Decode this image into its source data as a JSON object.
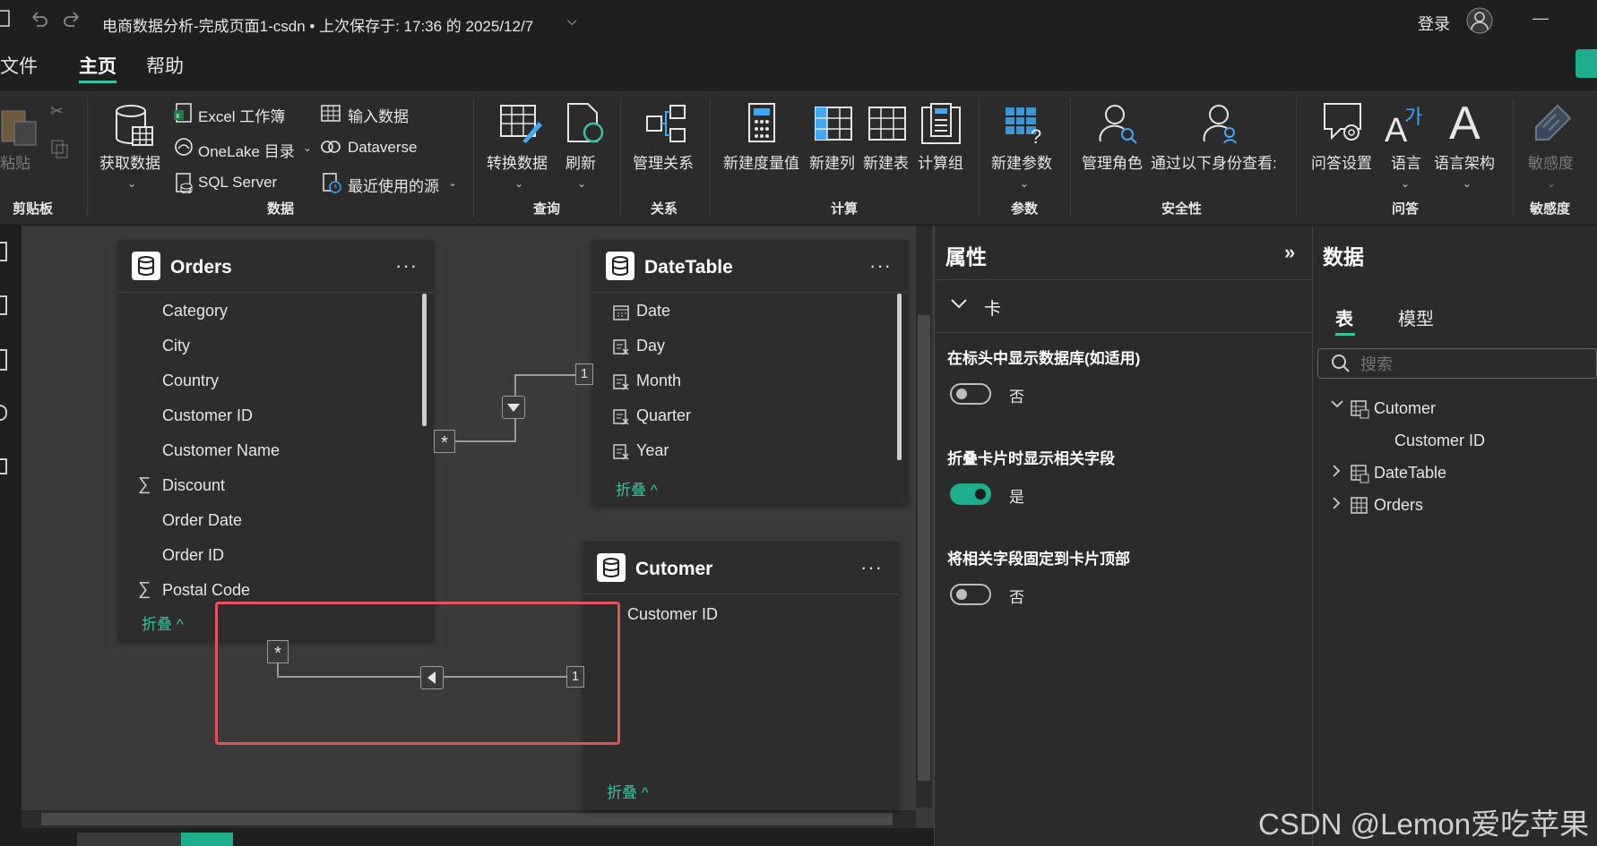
{
  "titlebar": {
    "title": "电商数据分析-完成页面1-csdn • 上次保存于: 17:36 的 2025/12/7",
    "login": "登录",
    "minimize": "—"
  },
  "menu": {
    "items": [
      "文件",
      "主页",
      "帮助"
    ],
    "active": "主页"
  },
  "ribbon": {
    "clipboard": {
      "paste": "粘贴",
      "group": "剪贴板"
    },
    "data": {
      "get_data": "获取数据",
      "excel": "Excel 工作簿",
      "onelake": "OneLake 目录",
      "sql": "SQL Server",
      "enter_data": "输入数据",
      "dataverse": "Dataverse",
      "recent": "最近使用的源",
      "group": "数据"
    },
    "query": {
      "transform": "转换数据",
      "refresh": "刷新",
      "group": "查询"
    },
    "relationships": {
      "manage": "管理关系",
      "group": "关系"
    },
    "calc": {
      "new_measure": "新建度量值",
      "new_column": "新建列",
      "new_table": "新建表",
      "calc_group": "计算组",
      "group": "计算"
    },
    "params": {
      "new_param": "新建参数",
      "group": "参数"
    },
    "security": {
      "manage_roles": "管理角色",
      "view_as": "通过以下身份查看:",
      "group": "安全性"
    },
    "qa": {
      "qa_settings": "问答设置",
      "language": "语言",
      "linguistic": "语言架构",
      "group": "问答"
    },
    "sensitivity": {
      "label": "敏感度",
      "group": "敏感度"
    }
  },
  "cards": {
    "orders": {
      "title": "Orders",
      "fields": [
        "Category",
        "City",
        "Country",
        "Customer ID",
        "Customer Name",
        "Discount",
        "Order Date",
        "Order ID",
        "Postal Code"
      ],
      "collapse": "折叠 ^"
    },
    "datetable": {
      "title": "DateTable",
      "fields": [
        "Date",
        "Day",
        "Month",
        "Quarter",
        "Year"
      ],
      "collapse": "折叠 ^"
    },
    "cutomer": {
      "title": "Cutomer",
      "fields": [
        "Customer ID"
      ],
      "collapse": "折叠 ^"
    },
    "more": "···",
    "many": "*",
    "one": "1"
  },
  "properties": {
    "title": "属性",
    "section": "卡",
    "show_db": {
      "label": "在标头中显示数据库(如适用)",
      "value": "否",
      "on": false
    },
    "show_related": {
      "label": "折叠卡片时显示相关字段",
      "value": "是",
      "on": true
    },
    "pin_related": {
      "label": "将相关字段固定到卡片顶部",
      "value": "否",
      "on": false
    }
  },
  "datapanel": {
    "title": "数据",
    "tabs": [
      "表",
      "模型"
    ],
    "search_placeholder": "搜索",
    "tree": [
      {
        "label": "Cutomer",
        "expanded": true,
        "children": [
          "Customer ID"
        ]
      },
      {
        "label": "DateTable",
        "expanded": false
      },
      {
        "label": "Orders",
        "expanded": false
      }
    ]
  },
  "watermark": "CSDN @Lemon爱吃苹果",
  "colors": {
    "accent": "#37c2a3",
    "highlight": "#e8505b"
  }
}
